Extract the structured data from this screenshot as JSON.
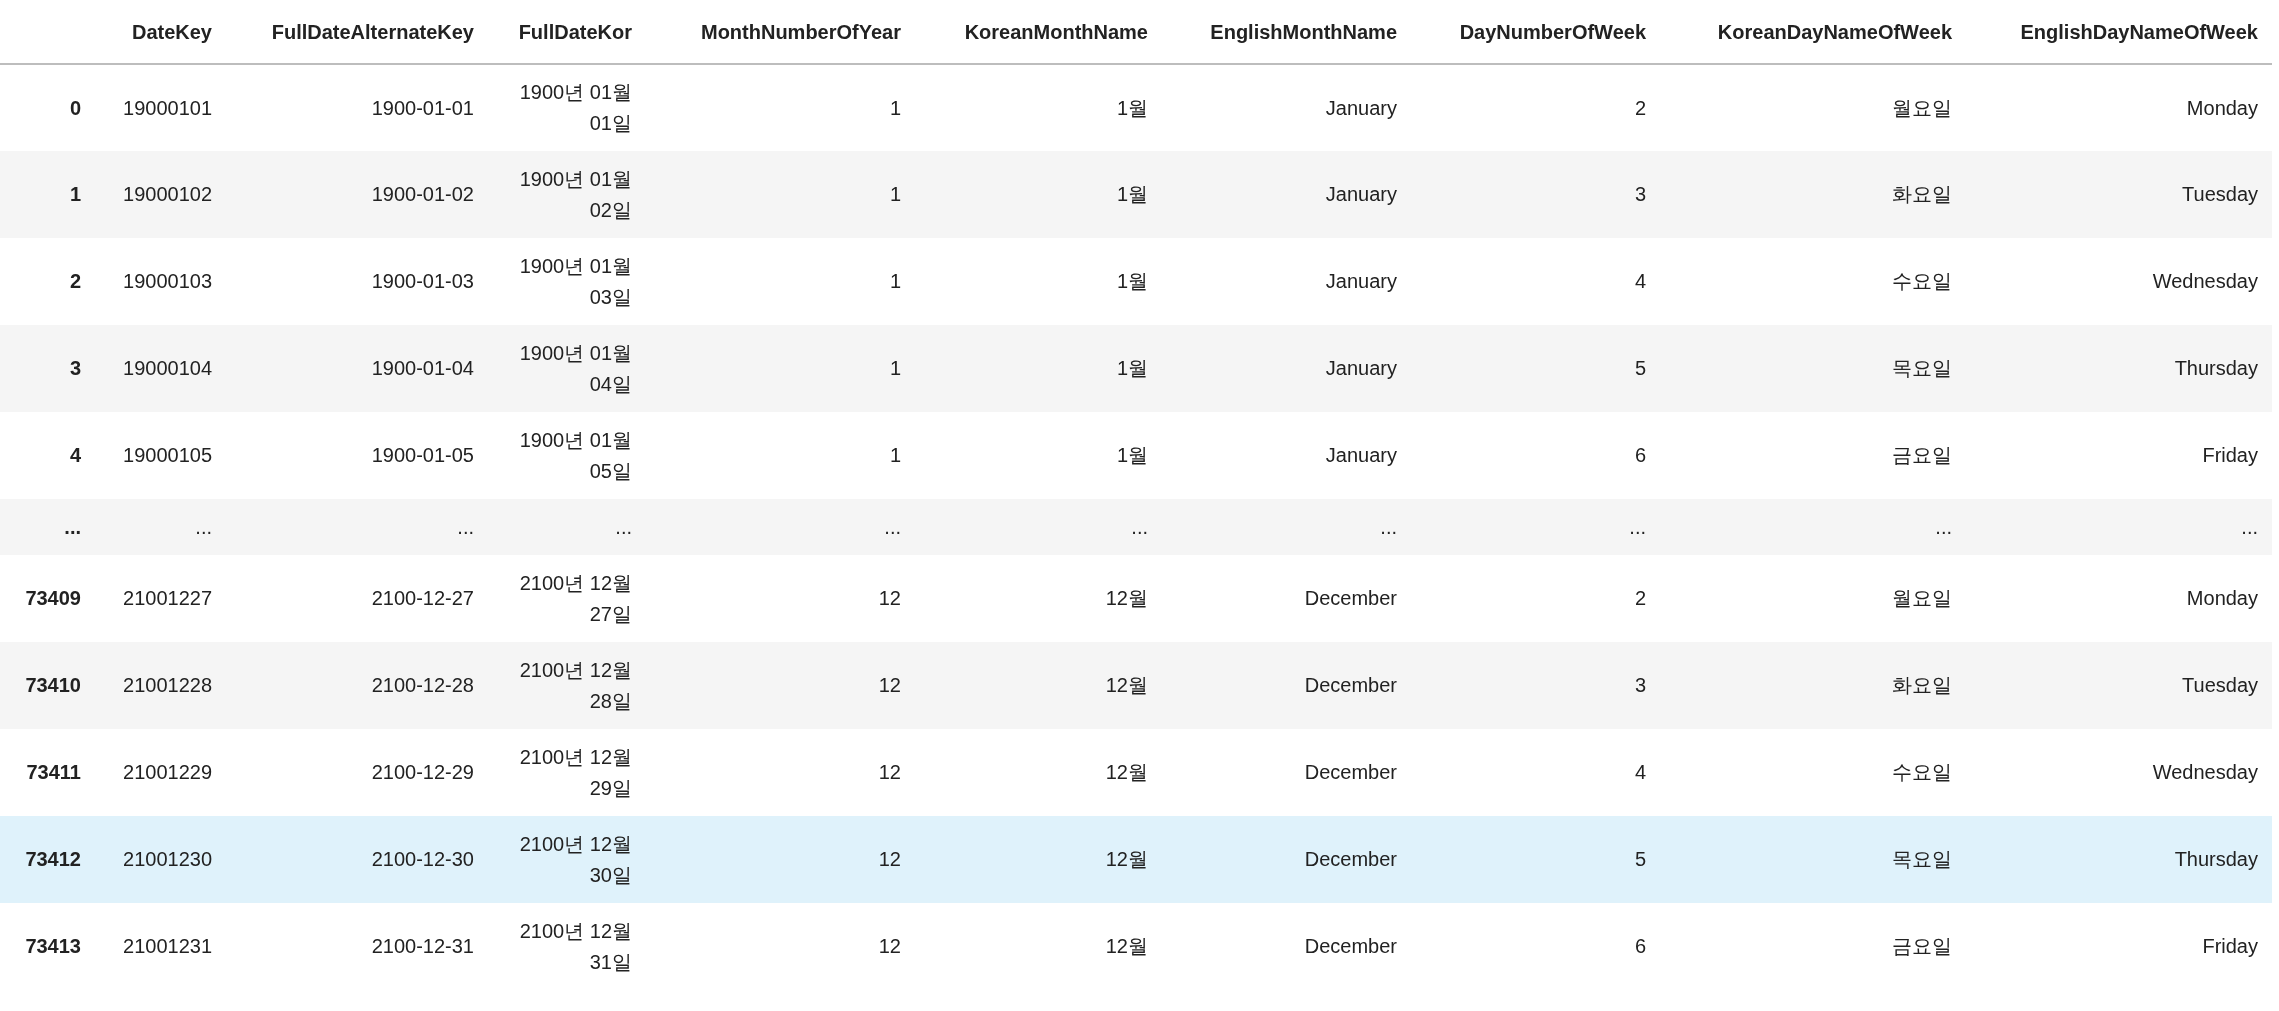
{
  "table": {
    "columns": [
      "",
      "DateKey",
      "FullDateAlternateKey",
      "FullDateKor",
      "MonthNumberOfYear",
      "KoreanMonthName",
      "EnglishMonthName",
      "DayNumberOfWeek",
      "KoreanDayNameOfWeek",
      "EnglishDayNameOfWeek"
    ],
    "rows": [
      {
        "kind": "data",
        "highlighted": false,
        "cells": [
          "0",
          "19000101",
          "1900-01-01",
          "1900년 01월 01일",
          "1",
          "1월",
          "January",
          "2",
          "월요일",
          "Monday"
        ]
      },
      {
        "kind": "data",
        "highlighted": false,
        "cells": [
          "1",
          "19000102",
          "1900-01-02",
          "1900년 01월 02일",
          "1",
          "1월",
          "January",
          "3",
          "화요일",
          "Tuesday"
        ]
      },
      {
        "kind": "data",
        "highlighted": false,
        "cells": [
          "2",
          "19000103",
          "1900-01-03",
          "1900년 01월 03일",
          "1",
          "1월",
          "January",
          "4",
          "수요일",
          "Wednesday"
        ]
      },
      {
        "kind": "data",
        "highlighted": false,
        "cells": [
          "3",
          "19000104",
          "1900-01-04",
          "1900년 01월 04일",
          "1",
          "1월",
          "January",
          "5",
          "목요일",
          "Thursday"
        ]
      },
      {
        "kind": "data",
        "highlighted": false,
        "cells": [
          "4",
          "19000105",
          "1900-01-05",
          "1900년 01월 05일",
          "1",
          "1월",
          "January",
          "6",
          "금요일",
          "Friday"
        ]
      },
      {
        "kind": "ellipsis",
        "highlighted": false,
        "cells": [
          "...",
          "...",
          "...",
          "...",
          "...",
          "...",
          "...",
          "...",
          "...",
          "..."
        ]
      },
      {
        "kind": "data",
        "highlighted": false,
        "cells": [
          "73409",
          "21001227",
          "2100-12-27",
          "2100년 12월 27일",
          "12",
          "12월",
          "December",
          "2",
          "월요일",
          "Monday"
        ]
      },
      {
        "kind": "data",
        "highlighted": false,
        "cells": [
          "73410",
          "21001228",
          "2100-12-28",
          "2100년 12월 28일",
          "12",
          "12월",
          "December",
          "3",
          "화요일",
          "Tuesday"
        ]
      },
      {
        "kind": "data",
        "highlighted": false,
        "cells": [
          "73411",
          "21001229",
          "2100-12-29",
          "2100년 12월 29일",
          "12",
          "12월",
          "December",
          "4",
          "수요일",
          "Wednesday"
        ]
      },
      {
        "kind": "data",
        "highlighted": true,
        "cells": [
          "73412",
          "21001230",
          "2100-12-30",
          "2100년 12월 30일",
          "12",
          "12월",
          "December",
          "5",
          "목요일",
          "Thursday"
        ]
      },
      {
        "kind": "data",
        "highlighted": false,
        "cells": [
          "73413",
          "21001231",
          "2100-12-31",
          "2100년 12월 31일",
          "12",
          "12월",
          "December",
          "6",
          "금요일",
          "Friday"
        ]
      }
    ]
  }
}
